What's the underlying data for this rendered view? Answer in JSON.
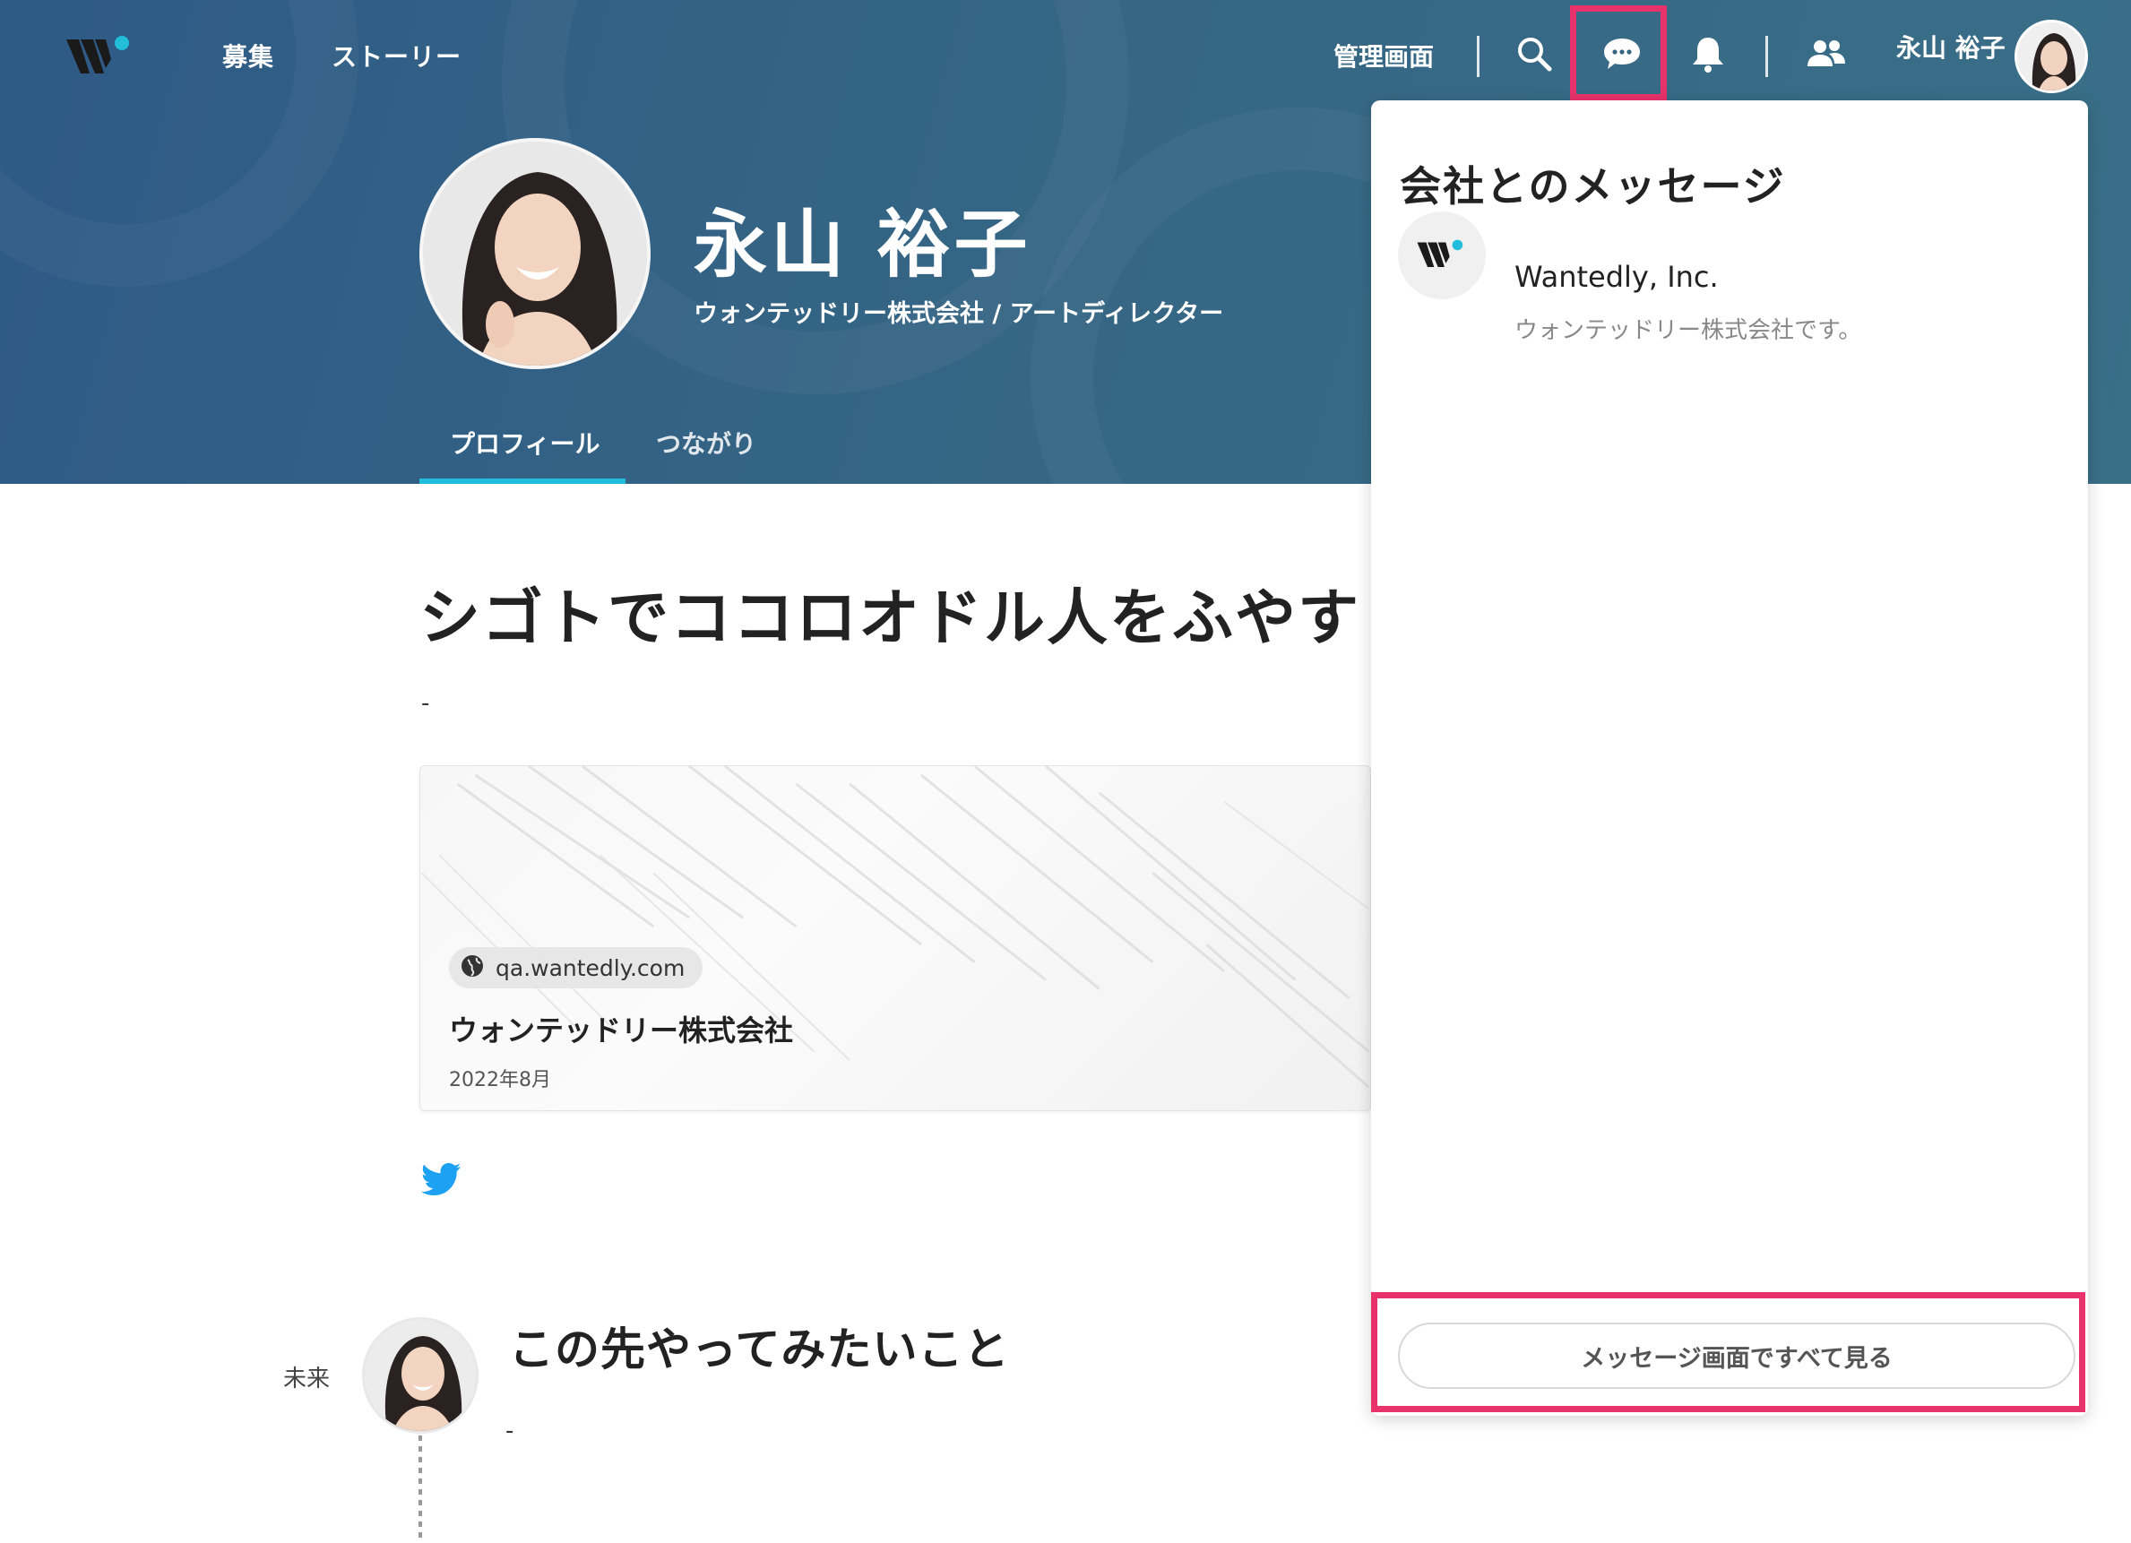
{
  "header": {
    "nav": [
      "募集",
      "ストーリー"
    ],
    "admin_label": "管理画面",
    "user_name": "永山 裕子",
    "icons": [
      "search-icon",
      "chat-icon",
      "bell-icon",
      "people-icon"
    ],
    "highlight_color": "#e8326b"
  },
  "profile": {
    "name": "永山 裕子",
    "subtitle": "ウォンテッドリー株式会社 / アートディレクター",
    "tabs": [
      "プロフィール",
      "つながり"
    ],
    "accent_color": "#21bddb"
  },
  "main": {
    "headline": "シゴトでココロオドル人をふやす",
    "headline_body": "-",
    "card": {
      "domain": "qa.wantedly.com",
      "title": "ウォンテッドリー株式会社",
      "date": "2022年8月"
    },
    "future": {
      "label": "未来",
      "title": "この先やってみたいこと",
      "body": "-"
    }
  },
  "messages_panel": {
    "title": "会社とのメッセージ",
    "items": [
      {
        "company": "Wantedly, Inc.",
        "preview": "ウォンテッドリー株式会社です。"
      }
    ],
    "see_all_label": "メッセージ画面ですべて見る"
  }
}
